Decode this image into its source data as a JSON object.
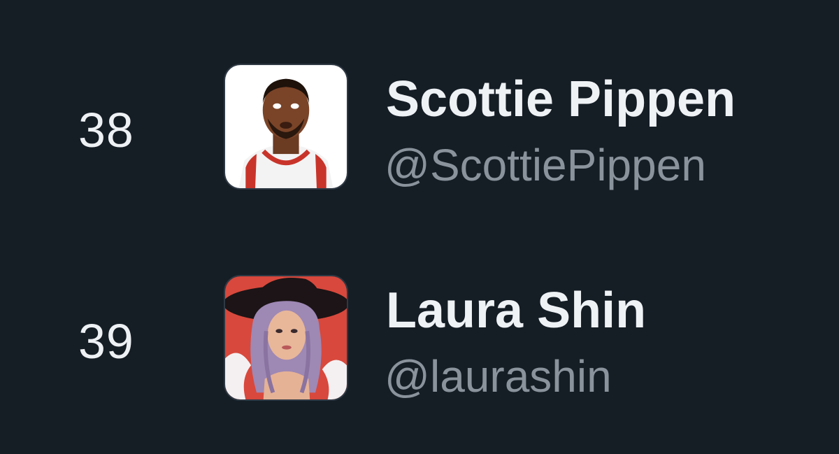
{
  "accounts": [
    {
      "rank": "38",
      "display_name": "Scottie Pippen",
      "handle": "@ScottiePippen",
      "avatar_icon": "basketball-player-avatar"
    },
    {
      "rank": "39",
      "display_name": "Laura Shin",
      "handle": "@laurashin",
      "avatar_icon": "illustrated-woman-avatar"
    }
  ],
  "colors": {
    "background": "#151d25",
    "primary_text": "#eef2f5",
    "secondary_text": "#8a939c"
  }
}
